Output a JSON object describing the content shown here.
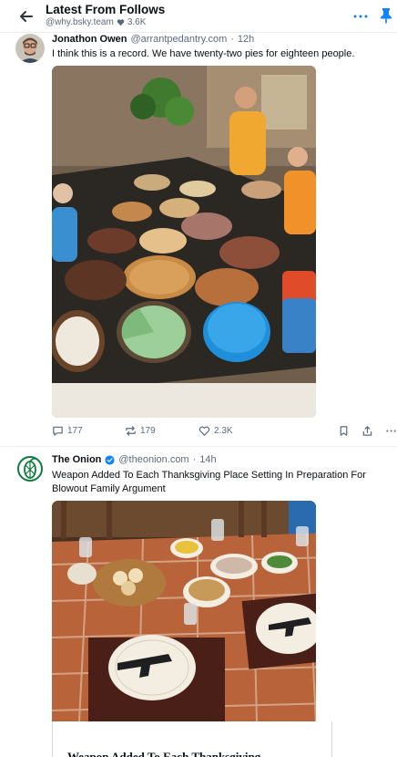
{
  "header": {
    "title": "Latest From Follows",
    "handle": "@why.bsky.team",
    "likes": "3.6K"
  },
  "posts": [
    {
      "author": "Jonathon Owen",
      "handle": "@arrantpedantry.com",
      "dot": "·",
      "time": "12h",
      "text": "I think this is a record. We have twenty-two pies for eighteen people.",
      "counts": {
        "replies": "177",
        "reposts": "179",
        "likes": "2.3K"
      }
    },
    {
      "author": "The Onion",
      "handle": "@theonion.com",
      "dot": "·",
      "time": "14h",
      "text": "Weapon Added To Each Thanksgiving Place Setting In Preparation For Blowout Family Argument",
      "card_title": "Weapon Added To Each Thanksgiving"
    }
  ],
  "colors": {
    "accent": "#1083fe",
    "text": "#0b0f14",
    "muted": "#5b6b7d",
    "border": "#e6ecf0",
    "onion_green": "#0f7a3c"
  },
  "icons": {
    "back": "arrow-left-icon",
    "more": "ellipsis-icon",
    "pin": "pin-icon",
    "reply": "speech-bubble-icon",
    "repost": "repost-icon",
    "like": "heart-icon",
    "bookmark": "bookmark-icon",
    "share": "share-icon",
    "verified": "verified-check-icon"
  }
}
